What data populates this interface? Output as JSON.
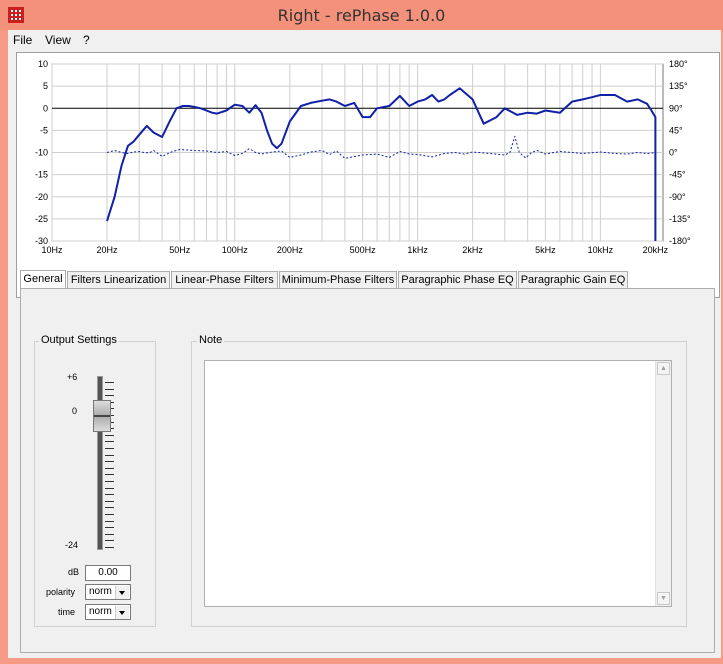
{
  "window": {
    "title": "Right  -  rePhase 1.0.0"
  },
  "menu": {
    "items": [
      "File",
      "View",
      "?"
    ]
  },
  "chart_data": {
    "type": "line",
    "x_ticks": [
      "10Hz",
      "20Hz",
      "50Hz",
      "100Hz",
      "200Hz",
      "500Hz",
      "1kHz",
      "2kHz",
      "5kHz",
      "10kHz",
      "20kHz"
    ],
    "x_tick_values": [
      10,
      20,
      50,
      100,
      200,
      500,
      1000,
      2000,
      5000,
      10000,
      20000
    ],
    "xlim": [
      10,
      22000
    ],
    "x_scale": "log",
    "y_left_ticks": [
      "10",
      "5",
      "0",
      "-5",
      "-10",
      "-15",
      "-20",
      "-25",
      "-30"
    ],
    "ylim_left": [
      -30,
      10
    ],
    "y_right_ticks": [
      "180°",
      "135°",
      "90°",
      "45°",
      "0°",
      "-45°",
      "-90°",
      "-135°",
      "-180°"
    ],
    "ylim_right": [
      -180,
      180
    ],
    "grid": true,
    "series": [
      {
        "style": "solid",
        "color": "#1020a8",
        "x": [
          20,
          22,
          24,
          26,
          28,
          30,
          33,
          36,
          40,
          44,
          48,
          52,
          56,
          60,
          65,
          70,
          75,
          80,
          90,
          100,
          110,
          120,
          130,
          140,
          150,
          160,
          170,
          180,
          200,
          230,
          260,
          300,
          330,
          360,
          400,
          450,
          500,
          550,
          600,
          700,
          800,
          900,
          1000,
          1100,
          1200,
          1300,
          1400,
          1500,
          1700,
          2000,
          2300,
          2700,
          3000,
          3500,
          4000,
          4500,
          5000,
          6000,
          7000,
          8000,
          9000,
          10000,
          12000,
          14000,
          16000,
          18000,
          19000,
          20000,
          20000
        ],
        "y": [
          -25.5,
          -20,
          -13,
          -8.5,
          -7.5,
          -6,
          -4,
          -5.5,
          -6.5,
          -3,
          0,
          0.5,
          0.5,
          0.3,
          0,
          -0.5,
          -1,
          -1.2,
          -0.5,
          0.8,
          0.5,
          -1,
          0.7,
          -1,
          -5,
          -8,
          -9,
          -8,
          -3,
          0.5,
          1.2,
          1.7,
          2,
          1.5,
          0.5,
          1.2,
          -2,
          -2,
          0,
          0.5,
          2.8,
          0.5,
          1.5,
          2,
          3,
          1.5,
          2,
          3,
          4.5,
          2,
          -3.5,
          -2,
          0,
          -1.5,
          -1,
          -1.2,
          -0.5,
          -1,
          1.5,
          2,
          2.5,
          3,
          3,
          1.5,
          2,
          1,
          -0.5,
          -2,
          -30
        ]
      },
      {
        "style": "dashed",
        "color": "#1020a8",
        "x": [
          20,
          22,
          24,
          26,
          28,
          30,
          32,
          34,
          36,
          40,
          45,
          50,
          60,
          70,
          80,
          90,
          100,
          110,
          120,
          130,
          140,
          160,
          180,
          200,
          230,
          260,
          300,
          330,
          360,
          400,
          500,
          600,
          700,
          800,
          900,
          1000,
          1200,
          1400,
          1600,
          1800,
          2000,
          2500,
          3000,
          3200,
          3400,
          3600,
          3900,
          4200,
          4500,
          5000,
          6000,
          7000,
          8000,
          10000,
          12000,
          14000,
          16000,
          18000,
          20000
        ],
        "y": [
          0,
          4,
          0,
          -2,
          1,
          2,
          0,
          -1,
          4,
          -8,
          1,
          6,
          4,
          3,
          0,
          2,
          -6,
          -2,
          8,
          0,
          -3,
          1,
          3,
          -10,
          -5,
          1,
          4,
          -4,
          3,
          -12,
          -5,
          -3,
          -10,
          2,
          -3,
          -4,
          -9,
          -2,
          0,
          -3,
          1,
          -2,
          -5,
          0,
          33,
          0,
          -11,
          0,
          4,
          -3,
          2,
          0,
          -2,
          1,
          -2,
          -3,
          0,
          -2,
          0
        ]
      }
    ]
  },
  "tabs": [
    "General",
    "Filters Linearization",
    "Linear-Phase Filters",
    "Minimum-Phase Filters",
    "Paragraphic Phase EQ",
    "Paragraphic Gain EQ"
  ],
  "output_settings": {
    "title": "Output Settings",
    "scale_top": "+6",
    "scale_zero": "0",
    "scale_bottom": "-24",
    "db_label": "dB",
    "db_value": "0.00",
    "polarity_label": "polarity",
    "polarity_value": "norm",
    "time_label": "time",
    "time_value": "norm"
  },
  "note": {
    "title": "Note",
    "text": ""
  }
}
